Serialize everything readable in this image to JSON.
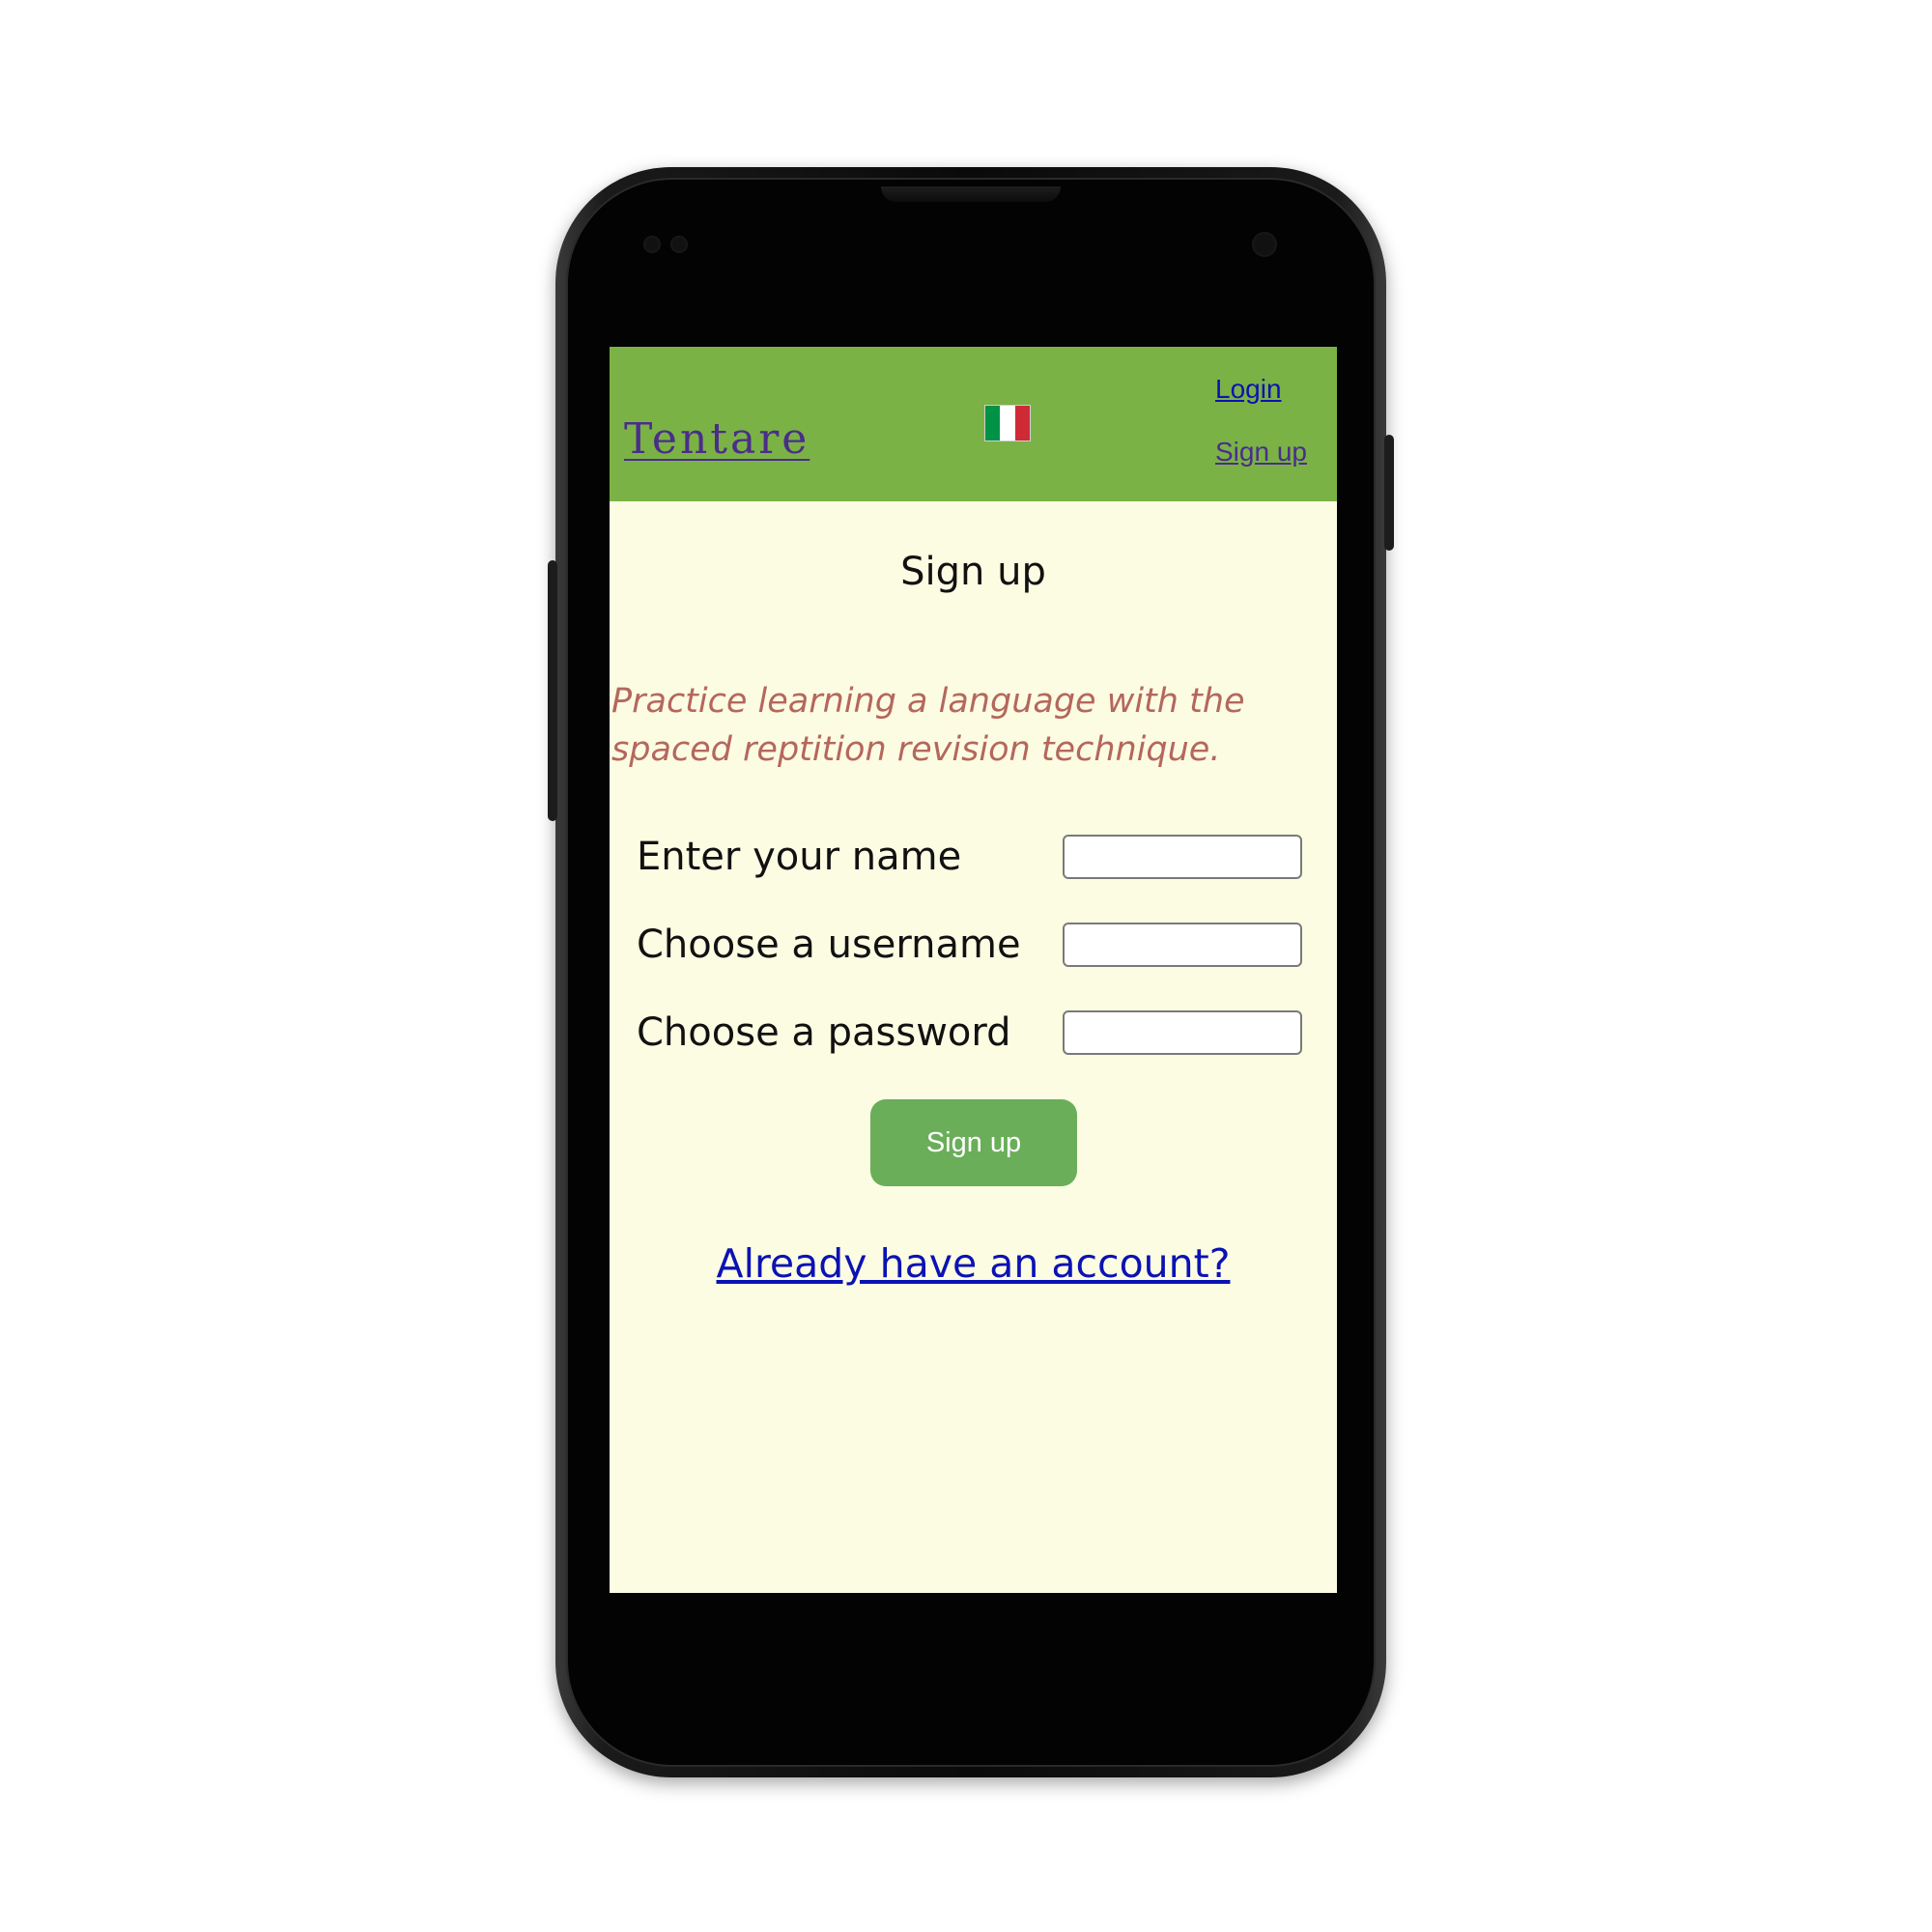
{
  "header": {
    "brand": "Tentare",
    "language_flag": {
      "icon": "italy-flag-icon",
      "colors": [
        "#009246",
        "#ffffff",
        "#ce2b37"
      ]
    },
    "login_link": "Login",
    "signup_link": "Sign up"
  },
  "page": {
    "title": "Sign up",
    "tagline": "Practice learning a language with the spaced reptition revision technique."
  },
  "form": {
    "name_label": "Enter your name",
    "name_value": "",
    "username_label": "Choose a username",
    "username_value": "",
    "password_label": "Choose a password",
    "password_value": "",
    "submit_label": "Sign up"
  },
  "footer": {
    "account_link": "Already have an account?"
  },
  "colors": {
    "navbar": "#7ab245",
    "background": "#fcfce3",
    "button": "#6aae5a",
    "tagline": "#b5675c",
    "link": "#0b12b4",
    "visited_link": "#4a2d8a"
  }
}
